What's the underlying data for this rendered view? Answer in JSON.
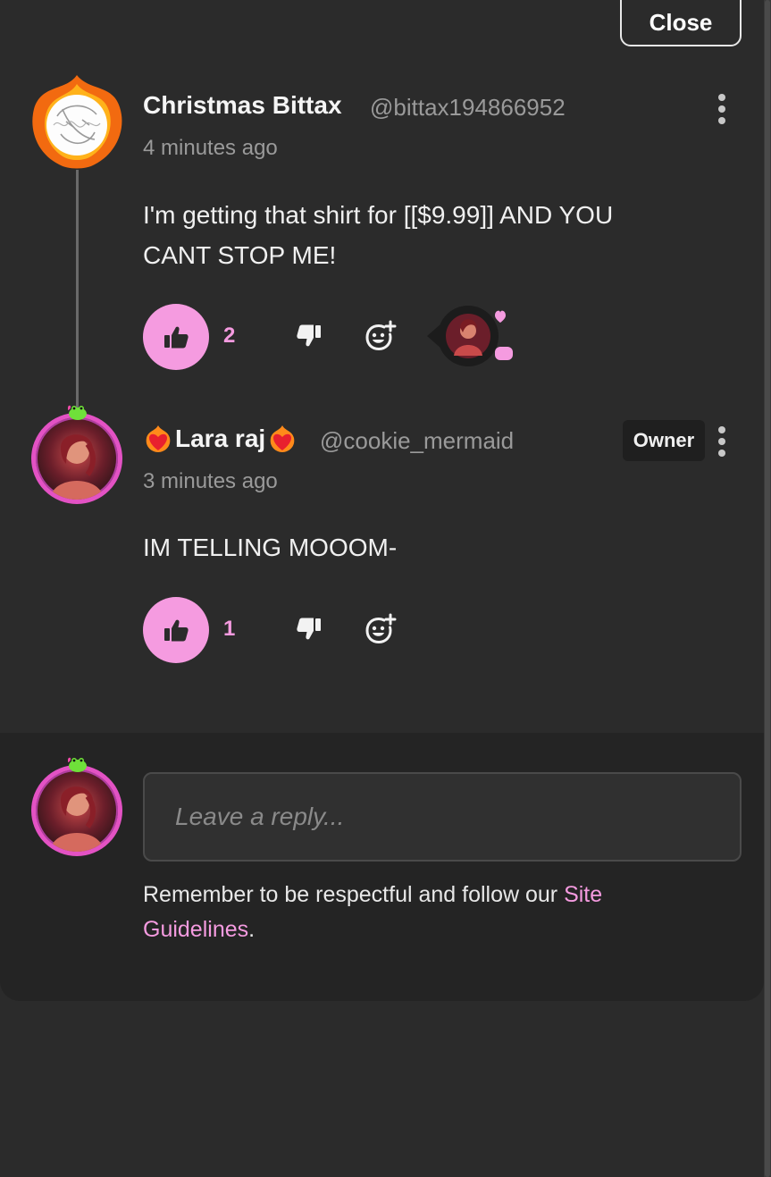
{
  "close_label": "Close",
  "comments": [
    {
      "name": "Christmas Bittax",
      "handle": "@bittax194866952",
      "time": "4 minutes ago",
      "text_line1": "I'm getting that shirt for [[$9.99]] AND YOU",
      "text_line2": "CANT STOP ME!",
      "likes": "2"
    },
    {
      "name": "Lara raj",
      "handle": "@cookie_mermaid",
      "badge": "Owner",
      "time": "3 minutes ago",
      "text": "IM TELLING MOOOM-",
      "likes": "1"
    }
  ],
  "reply": {
    "placeholder": "Leave a reply...",
    "notice_prefix": "Remember to be respectful and follow our ",
    "link_part1": "Site",
    "link_part2": "Guidelines",
    "notice_suffix": "."
  },
  "colors": {
    "accent": "#f59be0",
    "background": "#2b2b2b",
    "panel": "#242424"
  }
}
